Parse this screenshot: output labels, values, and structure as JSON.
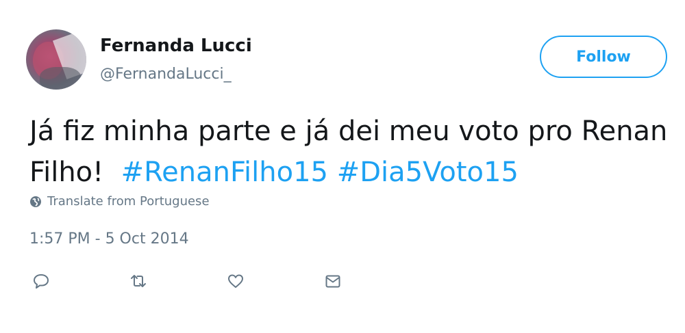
{
  "author": {
    "name": "Fernanda Lucci",
    "handle": "@FernandaLucci_"
  },
  "follow_button": {
    "label": "Follow"
  },
  "tweet": {
    "text_plain": "Já fiz minha parte e já dei meu voto pro Renan Filho!",
    "hashtags": [
      "#RenanFilho15",
      "#Dia5Voto15"
    ]
  },
  "translate": {
    "label": "Translate from Portuguese",
    "icon": "globe-icon"
  },
  "timestamp": "1:57 PM - 5 Oct 2014",
  "actions": [
    {
      "name": "reply",
      "icon": "reply-icon"
    },
    {
      "name": "retweet",
      "icon": "retweet-icon"
    },
    {
      "name": "like",
      "icon": "heart-icon"
    },
    {
      "name": "direct-message",
      "icon": "envelope-icon"
    }
  ],
  "colors": {
    "accent": "#1da1f2",
    "text": "#14171a",
    "muted": "#657786"
  }
}
